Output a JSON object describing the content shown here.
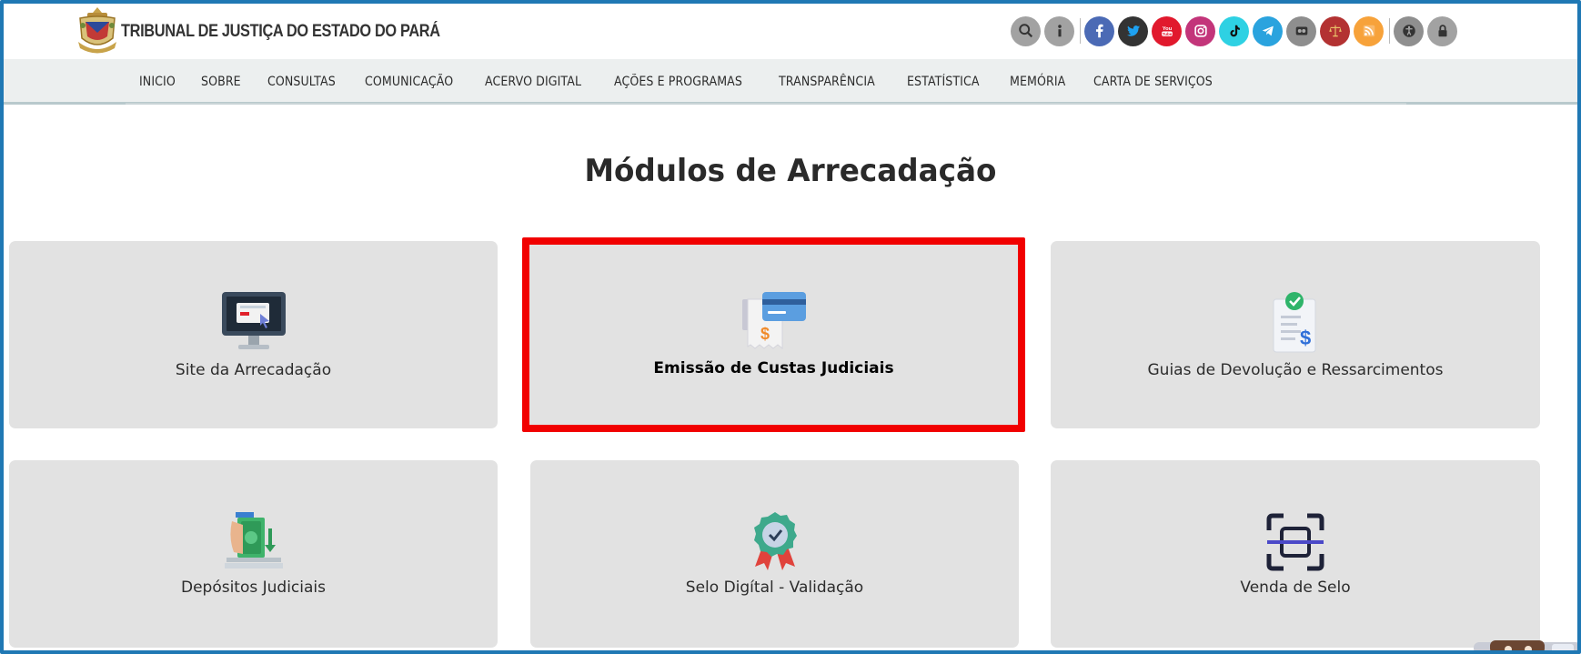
{
  "header": {
    "brand_name": "TRIBUNAL DE JUSTIÇA DO ESTADO DO PARÁ",
    "logo_icon": "tjpa-coat-of-arms-icon",
    "icons": [
      {
        "name": "search-icon",
        "color": "#9e9e9e",
        "glyph": "search"
      },
      {
        "name": "info-icon",
        "color": "#9e9e9e",
        "glyph": "i"
      },
      {
        "name": "facebook-icon",
        "color": "#4b6ab5",
        "glyph": "f"
      },
      {
        "name": "twitter-icon",
        "color": "#333333",
        "glyph": "bird"
      },
      {
        "name": "youtube-icon",
        "color": "#e1192d",
        "glyph": "You"
      },
      {
        "name": "instagram-icon",
        "color": "#c3357a",
        "glyph": "ig"
      },
      {
        "name": "tiktok-icon",
        "color": "#2ed1e3",
        "glyph": "tt"
      },
      {
        "name": "telegram-icon",
        "color": "#2aa3de",
        "glyph": "tg"
      },
      {
        "name": "flickr-icon",
        "color": "#8e8e8e",
        "glyph": "fl"
      },
      {
        "name": "justice-scales-icon",
        "color": "#b33232",
        "glyph": "sc"
      },
      {
        "name": "rss-icon",
        "color": "#f7a23a",
        "glyph": "rss"
      },
      {
        "name": "accessibility-icon",
        "color": "#8f8f8f",
        "glyph": "acc"
      },
      {
        "name": "lock-icon",
        "color": "#9e9e9e",
        "glyph": "lock"
      }
    ]
  },
  "nav": {
    "items": [
      "INICIO",
      "SOBRE",
      "CONSULTAS",
      "COMUNICAÇÃO",
      "ACERVO DIGITAL",
      "AÇÕES E PROGRAMAS",
      "TRANSPARÊNCIA",
      "ESTATÍSTICA",
      "MEMÓRIA",
      "CARTA DE SERVIÇOS"
    ]
  },
  "main": {
    "title": "Módulos de Arrecadação",
    "cards": [
      {
        "label": "Site da Arrecadação",
        "icon": "computer-monitor-icon",
        "selected": false
      },
      {
        "label": "Emissão de Custas Judiciais",
        "icon": "credit-card-receipt-icon",
        "selected": true
      },
      {
        "label": "Guias de Devolução e Ressarcimentos",
        "icon": "document-dollar-check-icon",
        "selected": false
      },
      {
        "label": "Depósitos Judiciais",
        "icon": "cash-deposit-icon",
        "selected": false
      },
      {
        "label": "Selo Digítal - Validação",
        "icon": "award-badge-icon",
        "selected": false
      },
      {
        "label": "Venda de Selo",
        "icon": "scan-frame-icon",
        "selected": false
      }
    ],
    "selection_color": "#f10000"
  }
}
